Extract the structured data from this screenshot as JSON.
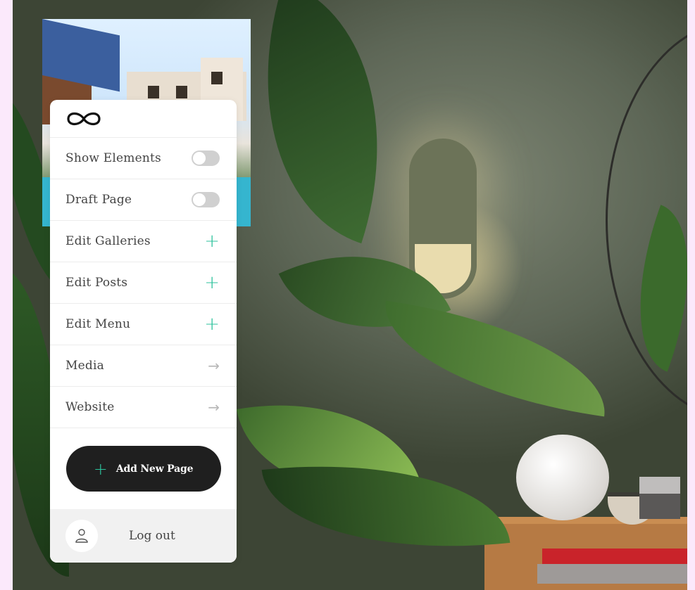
{
  "menu": {
    "logo_icon": "infinity-icon",
    "items": [
      {
        "label": "Show Elements",
        "control": "toggle",
        "state": "off"
      },
      {
        "label": "Draft Page",
        "control": "toggle",
        "state": "off"
      },
      {
        "label": "Edit Galleries",
        "control": "plus-icon"
      },
      {
        "label": "Edit Posts",
        "control": "plus-icon"
      },
      {
        "label": "Edit Menu",
        "control": "plus-icon"
      },
      {
        "label": "Media",
        "control": "arrow-right-icon"
      },
      {
        "label": "Website",
        "control": "arrow-right-icon"
      }
    ],
    "add_button": {
      "label": "Add New Page",
      "icon": "plus-icon"
    },
    "logout": {
      "label": "Log out",
      "icon": "user-icon"
    }
  },
  "colors": {
    "accent": "#2cc29c",
    "button_bg": "#1f1f1f",
    "page_bg": "#fbe9fb",
    "toggle_off": "#d0d0d0"
  }
}
